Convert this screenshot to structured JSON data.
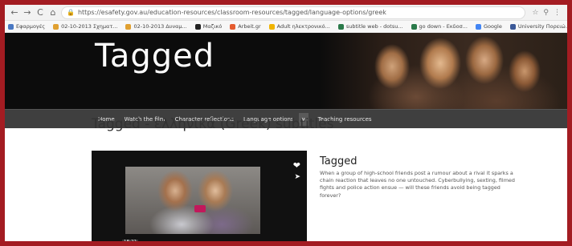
{
  "browser": {
    "nav": {
      "back": "←",
      "forward": "→",
      "reload": "C",
      "home": "⌂"
    },
    "url": "https://esafety.gov.au/education-resources/classroom-resources/tagged/language-options/greek",
    "right_icons": [
      "☆",
      "⚲",
      "⋮"
    ],
    "bookmarks": [
      {
        "label": "Εφαρμογές",
        "color": "#4a78c2"
      },
      {
        "label": "02-10-2013 Σχηματ...",
        "color": "#e0a030"
      },
      {
        "label": "02-10-2013 Δυναμ...",
        "color": "#e0a030"
      },
      {
        "label": "Μαζικό",
        "color": "#222222"
      },
      {
        "label": "Arbeit.gr",
        "color": "#e55c2f"
      },
      {
        "label": "Adult ηλεκτρονικό...",
        "color": "#f0b400"
      },
      {
        "label": "subtitle web - dotsu...",
        "color": "#2a7a4a"
      },
      {
        "label": "go down - Εκδοσ...",
        "color": "#2a7a4a"
      },
      {
        "label": "Google",
        "color": "#4285f4"
      },
      {
        "label": "University Πορειώ...",
        "color": "#3b5998"
      }
    ]
  },
  "site": {
    "title": "Tagged",
    "menu": [
      "Home",
      "Watch the film",
      "Character reflections",
      "Language options",
      "Teaching resources"
    ],
    "menu_dropdown": "∨"
  },
  "page": {
    "heading": "Tagged - ελληνικά (Greek) subtitles"
  },
  "video": {
    "timecode": "18:22",
    "play_icon": "▶",
    "heart_icon": "❤",
    "share_icon": "➤",
    "control_icons": [
      "◀)",
      "⚙",
      "⛶"
    ]
  },
  "info": {
    "title": "Tagged",
    "description": "When a group of high-school friends post a rumour about a rival it sparks a chain reaction that leaves no one untouched. Cyberbullying, sexting, filmed fights and police action ensue — will these friends avoid being tagged forever?"
  }
}
